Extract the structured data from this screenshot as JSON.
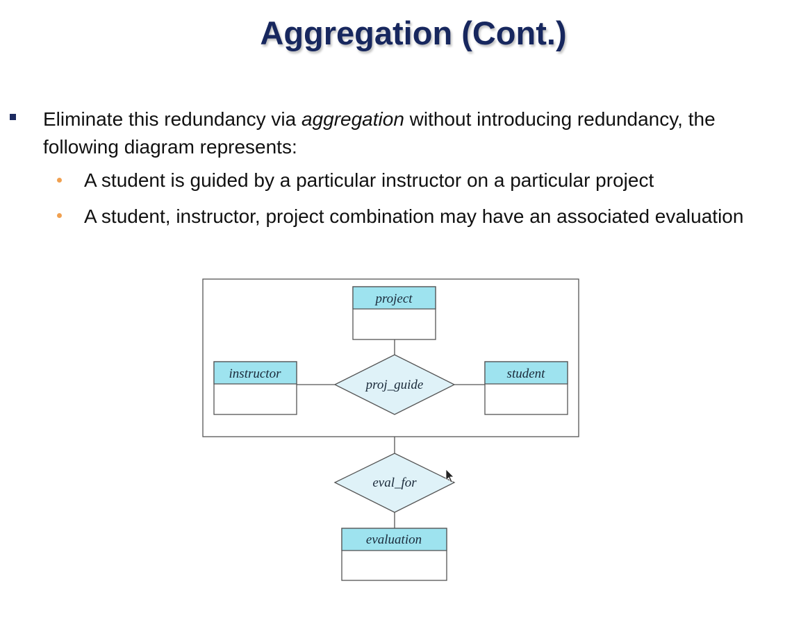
{
  "title": "Aggregation (Cont.)",
  "bullets": [
    {
      "pre": "Eliminate this redundancy via ",
      "em": "aggregation",
      "post": " without introducing redundancy, the following diagram represents:"
    }
  ],
  "sub_bullets": [
    "A student is guided by a particular instructor on a particular project",
    "A student, instructor, project combination may have an associated evaluation"
  ],
  "diagram": {
    "entities": {
      "project": "project",
      "instructor": "instructor",
      "student": "student",
      "evaluation": "evaluation"
    },
    "relationships": {
      "proj_guide": "proj_guide",
      "eval_for": "eval_for"
    },
    "colors": {
      "entity_header": "#9ee3ef",
      "relationship_fill": "#dff2f8",
      "stroke": "#555555"
    }
  }
}
